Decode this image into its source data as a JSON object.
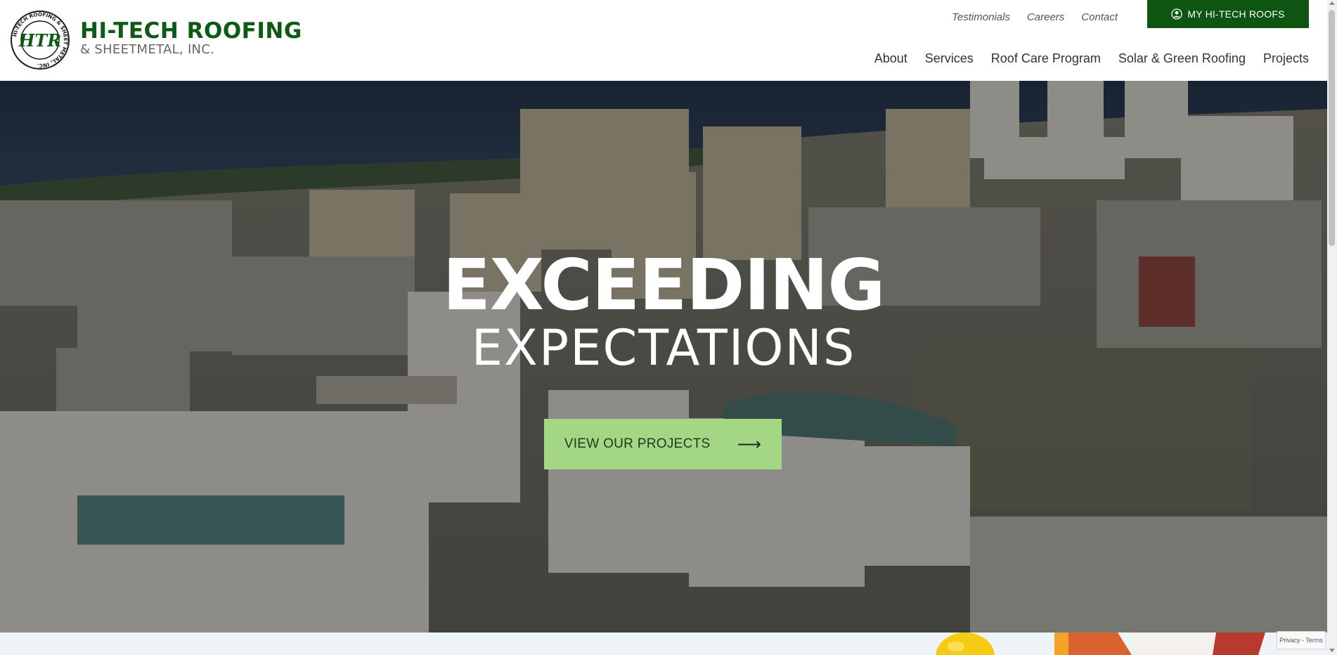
{
  "brand": {
    "name": "HI-TECH ROOFING",
    "sub": "& SHEETMETAL, INC.",
    "seal_initials": "HTR",
    "seal_ring_text": "HI-TECH ROOFING & SHEET METAL, INC."
  },
  "utility_nav": [
    "Testimonials",
    "Careers",
    "Contact"
  ],
  "portal_button": {
    "label": "MY HI-TECH ROOFS",
    "icon": "user-circle-icon"
  },
  "main_nav": [
    "About",
    "Services",
    "Roof Care Program",
    "Solar & Green Roofing",
    "Projects"
  ],
  "hero": {
    "title": "EXCEEDING",
    "subtitle": "EXPECTATIONS",
    "cta_label": "VIEW OUR PROJECTS",
    "cta_icon": "arrow-right-icon"
  },
  "recaptcha": {
    "label": "Privacy - Terms"
  },
  "colors": {
    "brand_green": "#0d5a16",
    "portal_green": "#0f5512",
    "cta_green": "#a3d784",
    "nav_text": "#333333",
    "strip_bg": "#eef3f8"
  }
}
